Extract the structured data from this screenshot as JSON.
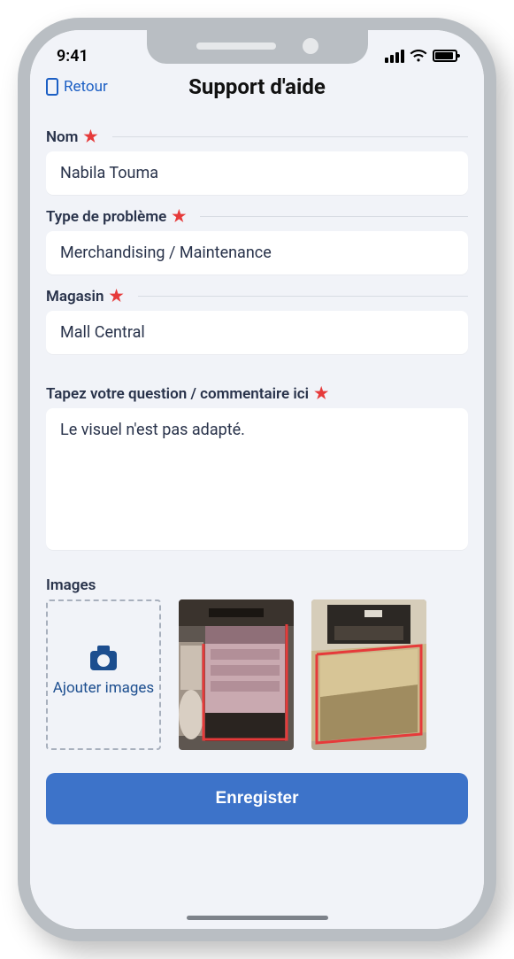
{
  "status": {
    "time": "9:41"
  },
  "header": {
    "back": "Retour",
    "title": "Support d'aide"
  },
  "fields": {
    "name": {
      "label": "Nom",
      "value": "Nabila Touma"
    },
    "problemType": {
      "label": "Type de problème",
      "value": "Merchandising / Maintenance"
    },
    "store": {
      "label": "Magasin",
      "value": "Mall Central"
    },
    "comment": {
      "label": "Tapez votre question / commentaire ici",
      "value": "Le visuel n'est pas adapté."
    }
  },
  "images": {
    "label": "Images",
    "addLabel": "Ajouter images"
  },
  "actions": {
    "save": "Enregister"
  }
}
